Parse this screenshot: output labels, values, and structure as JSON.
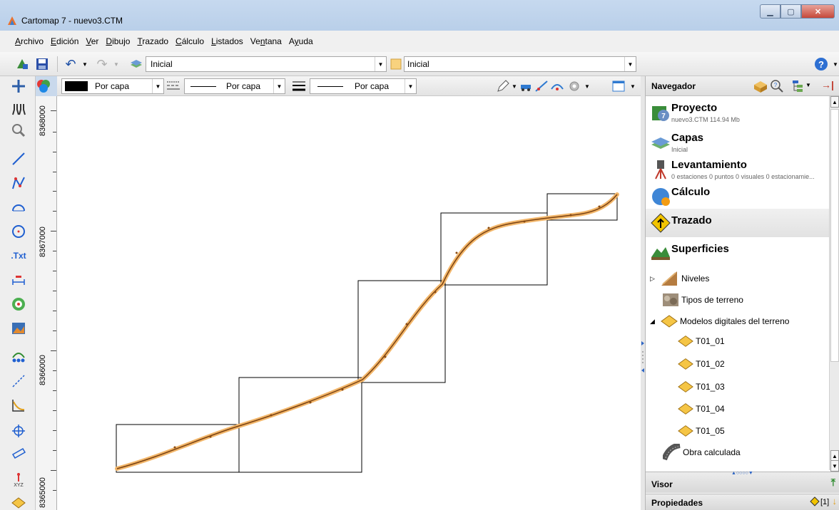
{
  "window": {
    "title": "Cartomap 7 - nuevo3.CTM"
  },
  "menu": [
    {
      "label": "Archivo"
    },
    {
      "label": "Edición"
    },
    {
      "label": "Ver"
    },
    {
      "label": "Dibujo"
    },
    {
      "label": "Trazado"
    },
    {
      "label": "Cálculo"
    },
    {
      "label": "Listados"
    },
    {
      "label": "Ventana"
    },
    {
      "label": "Ayuda"
    }
  ],
  "toolbar": {
    "layer_combo": "Inicial",
    "style_combo": "Inicial"
  },
  "props_toolbar": {
    "color_value": "Por capa",
    "linetype_value": "Por capa",
    "lineweight_value": "Por capa"
  },
  "ruler": {
    "labels": [
      "8368000",
      "8367000",
      "8366000",
      "8365000"
    ]
  },
  "navigator": {
    "title": "Navegador",
    "sections": [
      {
        "title": "Proyecto",
        "subtitle": "nuevo3.CTM 114.94 Mb"
      },
      {
        "title": "Capas",
        "subtitle": "Inicial"
      },
      {
        "title": "Levantamiento",
        "subtitle": "0 estaciones 0 puntos 0 visuales 0 estacionamie..."
      },
      {
        "title": "Cálculo",
        "subtitle": ""
      },
      {
        "title": "Trazado",
        "subtitle": ""
      },
      {
        "title": "Superficies",
        "subtitle": ""
      }
    ],
    "tree": {
      "niveles": "Niveles",
      "tipos_terreno": "Tipos de terreno",
      "modelos": "Modelos digitales del terreno",
      "models": [
        "T01_01",
        "T01_02",
        "T01_03",
        "T01_04",
        "T01_05"
      ],
      "obra": "Obra calculada"
    },
    "visor": "Visor",
    "propiedades": "Propiedades",
    "propiedades_count": "[1]"
  },
  "colors": {
    "road_light": "#f2b66a",
    "road_dark": "#7a4212",
    "frame": "#000000"
  }
}
